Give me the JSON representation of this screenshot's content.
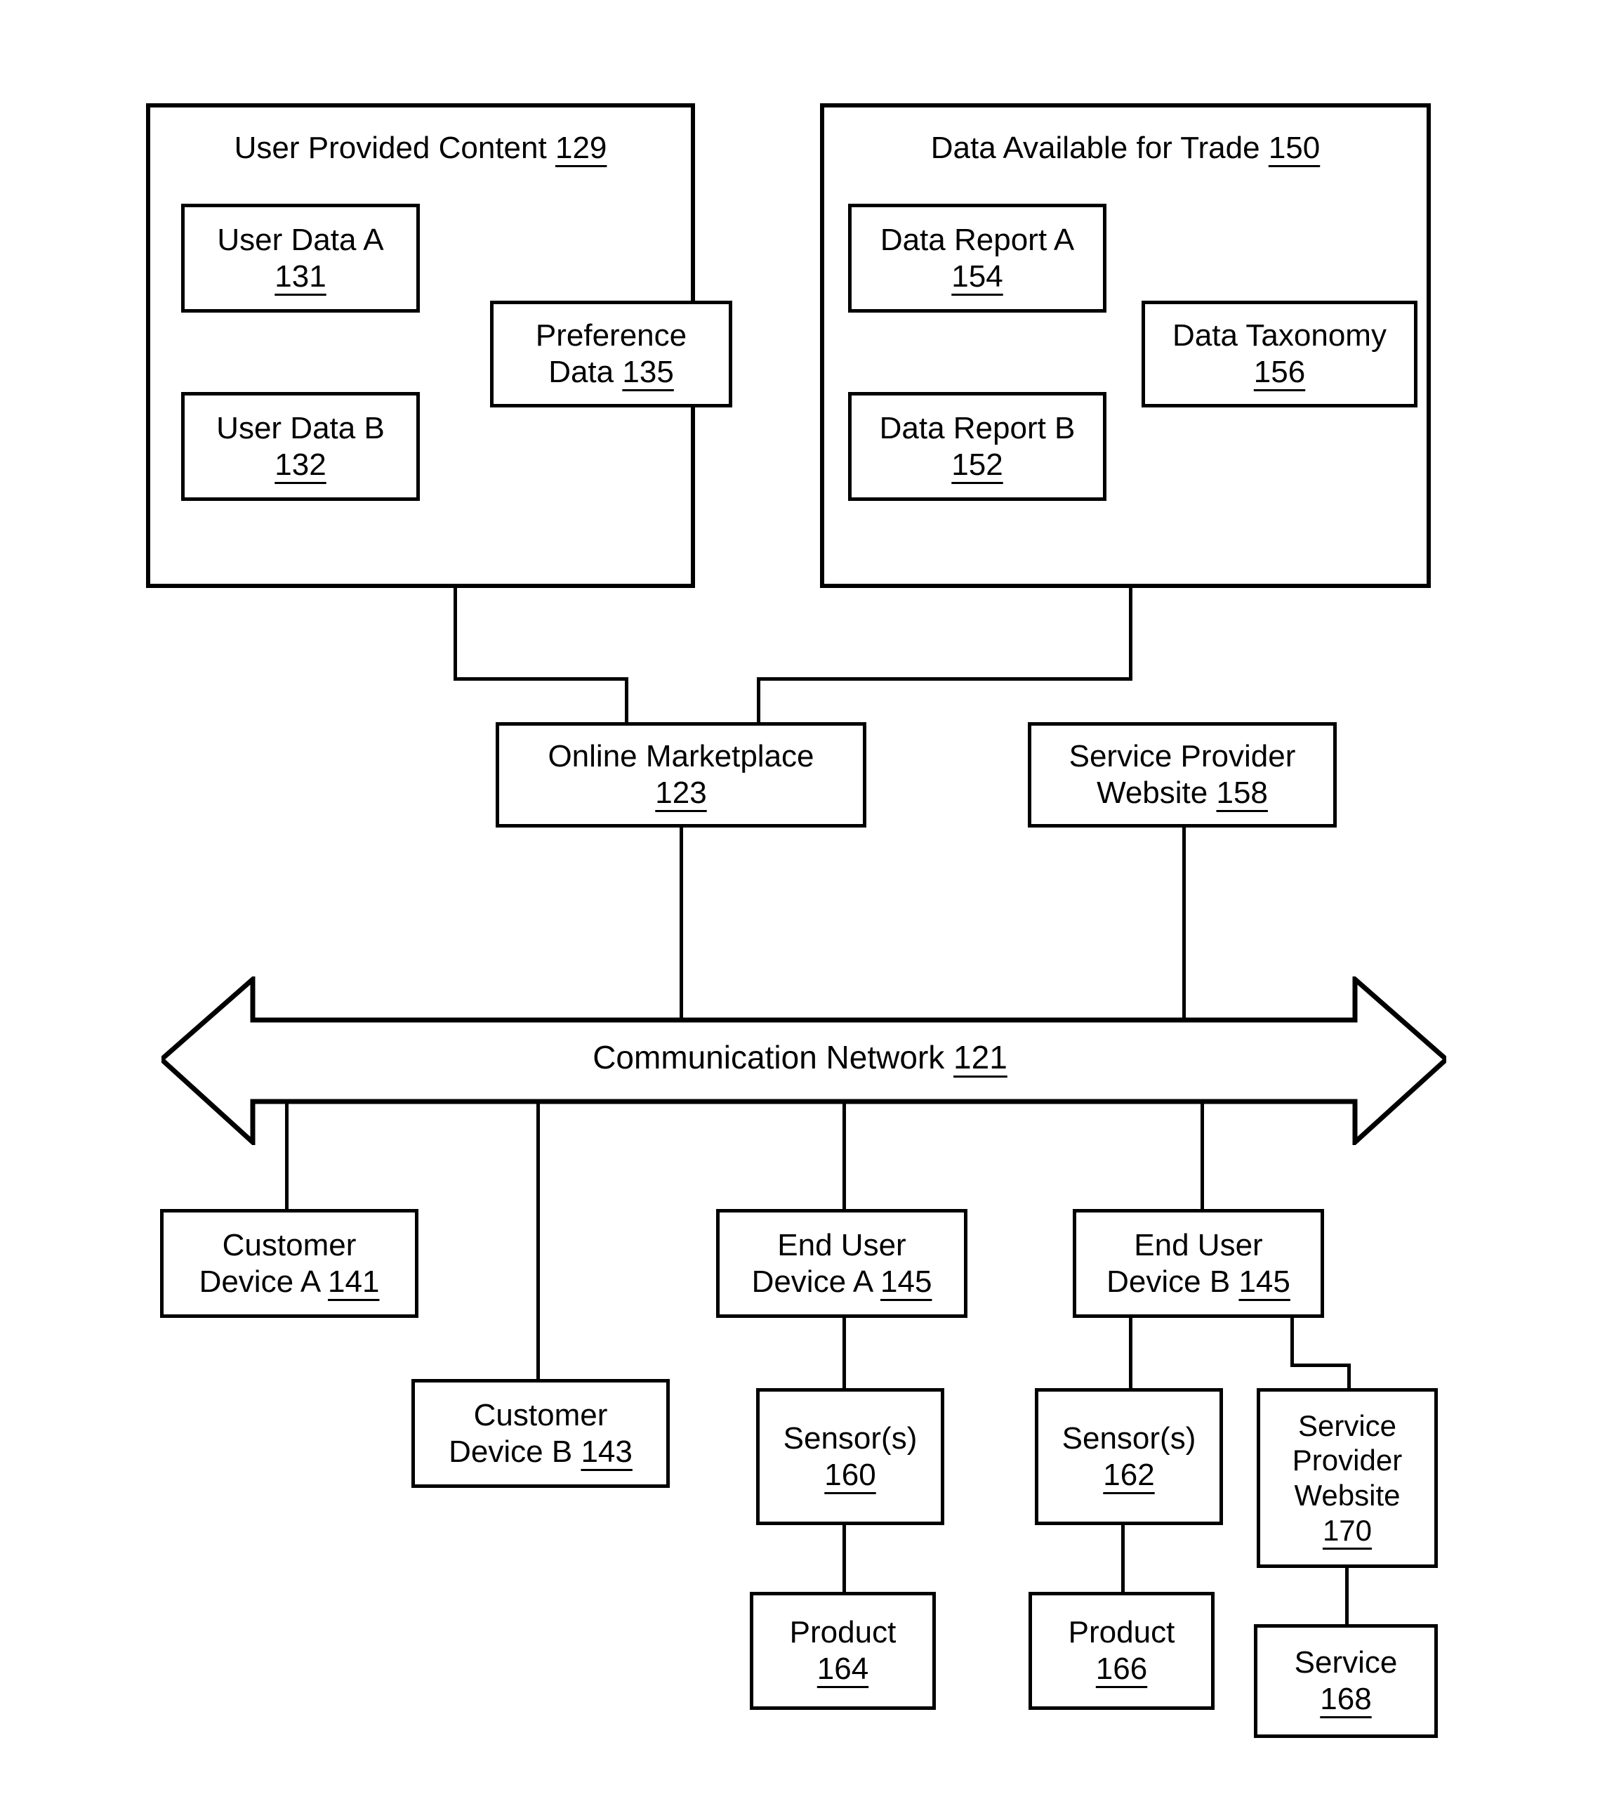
{
  "figure": {
    "type": "patent-block-diagram",
    "background_color": "#ffffff",
    "line_color": "#000000"
  },
  "containers": [
    {
      "name": "user-provided-content",
      "title": "User Provided Content",
      "ref": "129",
      "children": [
        {
          "name": "user-data-a",
          "label": "User Data A",
          "ref": "131"
        },
        {
          "name": "user-data-b",
          "label": "User Data B",
          "ref": "132"
        },
        {
          "name": "preference-data",
          "label_line1": "Preference",
          "label_line2": "Data",
          "ref": "135"
        }
      ]
    },
    {
      "name": "data-available-for-trade",
      "title": "Data Available for Trade",
      "ref": "150",
      "children": [
        {
          "name": "data-report-a",
          "label": "Data Report A",
          "ref": "154"
        },
        {
          "name": "data-report-b",
          "label": "Data Report B",
          "ref": "152"
        },
        {
          "name": "data-taxonomy",
          "label": "Data Taxonomy",
          "ref": "156"
        }
      ]
    }
  ],
  "mid": {
    "online_marketplace": {
      "label": "Online Marketplace",
      "ref": "123"
    },
    "service_provider_website": {
      "line1": "Service Provider",
      "line2": "Website",
      "ref": "158"
    }
  },
  "network": {
    "label": "Communication Network",
    "ref": "121"
  },
  "devices": {
    "customer_device_a": {
      "line1": "Customer",
      "line2": "Device A",
      "ref": "141"
    },
    "customer_device_b": {
      "line1": "Customer",
      "line2": "Device B",
      "ref": "143"
    },
    "end_user_device_a": {
      "line1": "End User",
      "line2": "Device A",
      "ref": "145"
    },
    "end_user_device_b": {
      "line1": "End User",
      "line2": "Device B",
      "ref": "145"
    },
    "sensors_a": {
      "label": "Sensor(s)",
      "ref": "160"
    },
    "sensors_b": {
      "label": "Sensor(s)",
      "ref": "162"
    },
    "product_a": {
      "label": "Product",
      "ref": "164"
    },
    "product_b": {
      "label": "Product",
      "ref": "166"
    },
    "service_provider_website_170": {
      "line1": "Service",
      "line2": "Provider",
      "line3": "Website",
      "ref": "170"
    },
    "service_168": {
      "label": "Service",
      "ref": "168"
    }
  }
}
